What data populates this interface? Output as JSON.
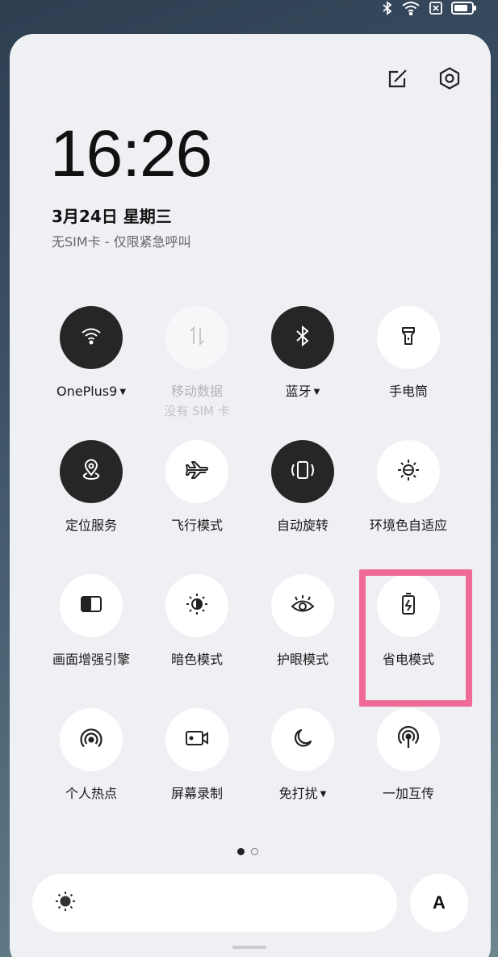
{
  "status_bar": {
    "icons": [
      "bluetooth-icon",
      "wifi-icon",
      "no-sim-icon",
      "battery-icon"
    ]
  },
  "header": {
    "actions": [
      "edit-icon",
      "settings-icon"
    ],
    "time": "16:26",
    "date": "3月24日 星期三",
    "sim_status": "无SIM卡 - 仅限紧急呼叫"
  },
  "tiles": [
    {
      "label": "OnePlus9",
      "icon": "wifi-icon",
      "state": "on",
      "has_dropdown": true
    },
    {
      "label": "移动数据",
      "sublabel": "没有 SIM 卡",
      "icon": "mobile-data-icon",
      "state": "disabled"
    },
    {
      "label": "蓝牙",
      "icon": "bluetooth-icon",
      "state": "on",
      "has_dropdown": true
    },
    {
      "label": "手电筒",
      "icon": "flashlight-icon",
      "state": "off"
    },
    {
      "label": "定位服务",
      "icon": "location-icon",
      "state": "on"
    },
    {
      "label": "飞行模式",
      "icon": "airplane-icon",
      "state": "off"
    },
    {
      "label": "自动旋转",
      "icon": "auto-rotate-icon",
      "state": "on"
    },
    {
      "label": "环境色自适应",
      "icon": "ambient-color-icon",
      "state": "off"
    },
    {
      "label": "画面增强引擎",
      "icon": "display-enhance-icon",
      "state": "off"
    },
    {
      "label": "暗色模式",
      "icon": "dark-mode-icon",
      "state": "off"
    },
    {
      "label": "护眼模式",
      "icon": "eye-comfort-icon",
      "state": "off"
    },
    {
      "label": "省电模式",
      "icon": "battery-saver-icon",
      "state": "off",
      "highlighted": true
    },
    {
      "label": "个人热点",
      "icon": "hotspot-icon",
      "state": "off"
    },
    {
      "label": "屏幕录制",
      "icon": "screen-record-icon",
      "state": "off"
    },
    {
      "label": "免打扰",
      "icon": "do-not-disturb-icon",
      "state": "off",
      "has_dropdown": true
    },
    {
      "label": "一加互传",
      "icon": "oneplus-share-icon",
      "state": "off"
    }
  ],
  "pagination": {
    "current": 1,
    "total": 2
  },
  "brightness": {
    "icon": "brightness-icon"
  },
  "auto_brightness": {
    "label": "A"
  },
  "colors": {
    "tile_on": "#262626",
    "tile_off": "#ffffff",
    "panel_bg": "#eef0f4",
    "highlight": "#f06a97"
  }
}
